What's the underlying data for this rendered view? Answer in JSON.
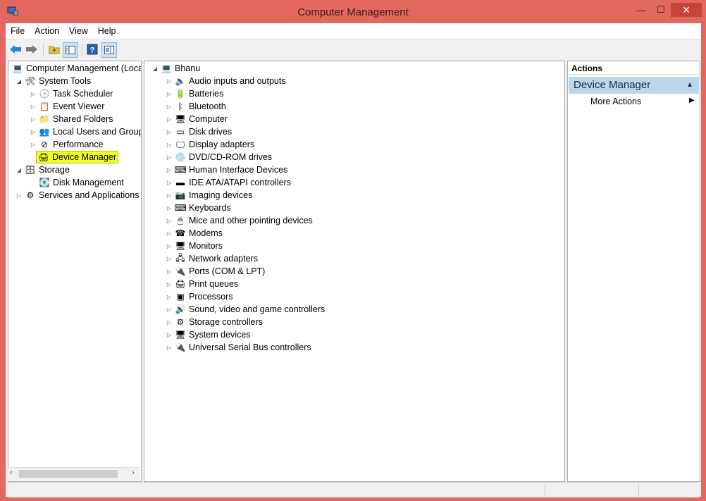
{
  "window": {
    "title": "Computer Management",
    "minimize_glyph": "—",
    "maximize_glyph": "☐",
    "close_glyph": "✕"
  },
  "menu": [
    "File",
    "Action",
    "View",
    "Help"
  ],
  "toolbar": {
    "icons": [
      "back-arrow-icon",
      "forward-arrow-icon",
      "up-folder-icon",
      "show-hide-tree-icon",
      "help-icon",
      "properties-icon"
    ]
  },
  "tree": {
    "root": "Computer Management (Local",
    "system_tools": "System Tools",
    "task_scheduler": "Task Scheduler",
    "event_viewer": "Event Viewer",
    "shared_folders": "Shared Folders",
    "local_users": "Local Users and Groups",
    "performance": "Performance",
    "device_manager": "Device Manager",
    "storage": "Storage",
    "disk_management": "Disk Management",
    "services": "Services and Applications"
  },
  "devices": {
    "computer_name": "Bhanu",
    "categories": [
      "Audio inputs and outputs",
      "Batteries",
      "Bluetooth",
      "Computer",
      "Disk drives",
      "Display adapters",
      "DVD/CD-ROM drives",
      "Human Interface Devices",
      "IDE ATA/ATAPI controllers",
      "Imaging devices",
      "Keyboards",
      "Mice and other pointing devices",
      "Modems",
      "Monitors",
      "Network adapters",
      "Ports (COM & LPT)",
      "Print queues",
      "Processors",
      "Sound, video and game controllers",
      "Storage controllers",
      "System devices",
      "Universal Serial Bus controllers"
    ],
    "icons": [
      "🔈",
      "🔋",
      "ᛒ",
      "🖥",
      "▭",
      "🖵",
      "💿",
      "⌨",
      "▬",
      "📷",
      "⌨",
      "🖱",
      "☎",
      "🖥",
      "🖧",
      "🔌",
      "🖨",
      "▣",
      "🔊",
      "⚙",
      "🖥",
      "🔌"
    ]
  },
  "actions": {
    "header": "Actions",
    "section": "Device Manager",
    "more": "More Actions"
  },
  "colors": {
    "title_bar": "#e2685f",
    "highlight": "#f0ff2a",
    "actions_section": "#bcd6ee"
  }
}
